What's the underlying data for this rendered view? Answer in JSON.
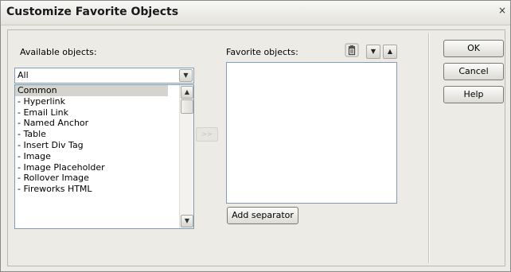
{
  "dialog": {
    "title": "Customize Favorite Objects",
    "close_icon": "×"
  },
  "available": {
    "label": "Available objects:",
    "combo_value": "All",
    "items": [
      "Common",
      "- Hyperlink",
      "- Email Link",
      "- Named Anchor",
      "- Table",
      "- Insert Div Tag",
      "- Image",
      "- Image Placeholder",
      "- Rollover Image",
      "- Fireworks HTML"
    ],
    "selected_index": 0
  },
  "move_button": {
    "label": ">>"
  },
  "favorites": {
    "label": "Favorite objects:",
    "items": []
  },
  "buttons": {
    "ok": "OK",
    "cancel": "Cancel",
    "help": "Help",
    "add_separator": "Add separator"
  },
  "icons": {
    "trash": "trash-icon",
    "move_down": "arrow-down-icon",
    "move_up": "arrow-up-icon"
  }
}
